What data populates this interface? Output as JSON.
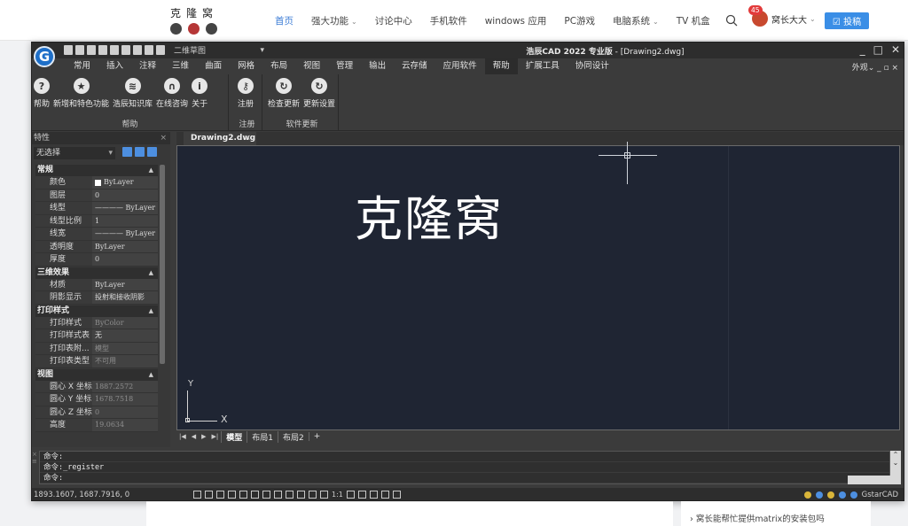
{
  "site": {
    "logo_text": "克隆窝",
    "nav": [
      {
        "label": "首页",
        "caret": ""
      },
      {
        "label": "强大功能",
        "caret": "⌄"
      },
      {
        "label": "讨论中心",
        "caret": ""
      },
      {
        "label": "手机软件",
        "caret": ""
      },
      {
        "label": "windows 应用",
        "caret": ""
      },
      {
        "label": "PC游戏",
        "caret": ""
      },
      {
        "label": "电脑系统",
        "caret": "⌄"
      },
      {
        "label": "TV 机盒",
        "caret": ""
      }
    ],
    "user": {
      "badge": "45",
      "name": "窝长大大",
      "caret": "⌄"
    },
    "post_button": "☑ 投稿",
    "side_link": "› 窝长能帮忙提供matrix的安装包吗"
  },
  "cad": {
    "logo": "G",
    "workspace": "二维草图",
    "title_prefix": "浩辰CAD 2022 专业版",
    "title_suffix": " - [Drawing2.dwg]",
    "menus": [
      "常用",
      "插入",
      "注释",
      "三维",
      "曲面",
      "网格",
      "布局",
      "视图",
      "管理",
      "输出",
      "云存储",
      "应用软件",
      "帮助",
      "扩展工具",
      "协同设计"
    ],
    "menu_right": "外观⌄  _  ▫  ×",
    "ribbon": {
      "group_help": {
        "label": "帮助",
        "buttons": [
          {
            "label": "帮助",
            "icon": "?"
          },
          {
            "label": "新增和特色功能",
            "icon": "★"
          },
          {
            "label": "浩辰知识库",
            "icon": "≋"
          },
          {
            "label": "在线咨询",
            "icon": "∩"
          },
          {
            "label": "关于",
            "icon": "i"
          }
        ]
      },
      "group_reg": {
        "label": "注册",
        "buttons": [
          {
            "label": "注册",
            "icon": "⚷"
          }
        ]
      },
      "group_update": {
        "label": "软件更新",
        "buttons": [
          {
            "label": "检查更新",
            "icon": "↻"
          },
          {
            "label": "更新设置",
            "icon": "↻"
          }
        ]
      }
    },
    "props": {
      "title": "特性",
      "selection": "无选择",
      "sections": [
        {
          "title": "常规",
          "rows": [
            {
              "name": "颜色",
              "value": "ByLayer"
            },
            {
              "name": "图层",
              "value": "0"
            },
            {
              "name": "线型",
              "value": "———— ByLayer"
            },
            {
              "name": "线型比例",
              "value": "1"
            },
            {
              "name": "线宽",
              "value": "———— ByLayer"
            },
            {
              "name": "透明度",
              "value": "ByLayer"
            },
            {
              "name": "厚度",
              "value": "0"
            }
          ]
        },
        {
          "title": "三维效果",
          "rows": [
            {
              "name": "材质",
              "value": "ByLayer"
            },
            {
              "name": "阴影显示",
              "value": "投射和接收阴影"
            }
          ]
        },
        {
          "title": "打印样式",
          "rows": [
            {
              "name": "打印样式",
              "value": "ByColor"
            },
            {
              "name": "打印样式表",
              "value": "无"
            },
            {
              "name": "打印表附...",
              "value": "模型"
            },
            {
              "name": "打印表类型",
              "value": "不可用"
            }
          ]
        },
        {
          "title": "视图",
          "rows": [
            {
              "name": "圆心 X 坐标",
              "value": "1887.2572"
            },
            {
              "name": "圆心 Y 坐标",
              "value": "1678.7518"
            },
            {
              "name": "圆心 Z 坐标",
              "value": "0"
            },
            {
              "name": "高度",
              "value": "19.0634"
            }
          ]
        }
      ]
    },
    "doc_tab": "Drawing2.dwg",
    "drawing_text": "克隆窝",
    "ucs": {
      "x": "X",
      "y": "Y"
    },
    "layout_tabs": [
      "模型",
      "布局1",
      "布局2",
      "+"
    ],
    "command_lines": [
      "命令:",
      "命令:_register",
      "命令:"
    ],
    "coords": "1893.1607, 1687.7916, 0",
    "status_scale": "1:1",
    "status_brand": "GstarCAD"
  }
}
